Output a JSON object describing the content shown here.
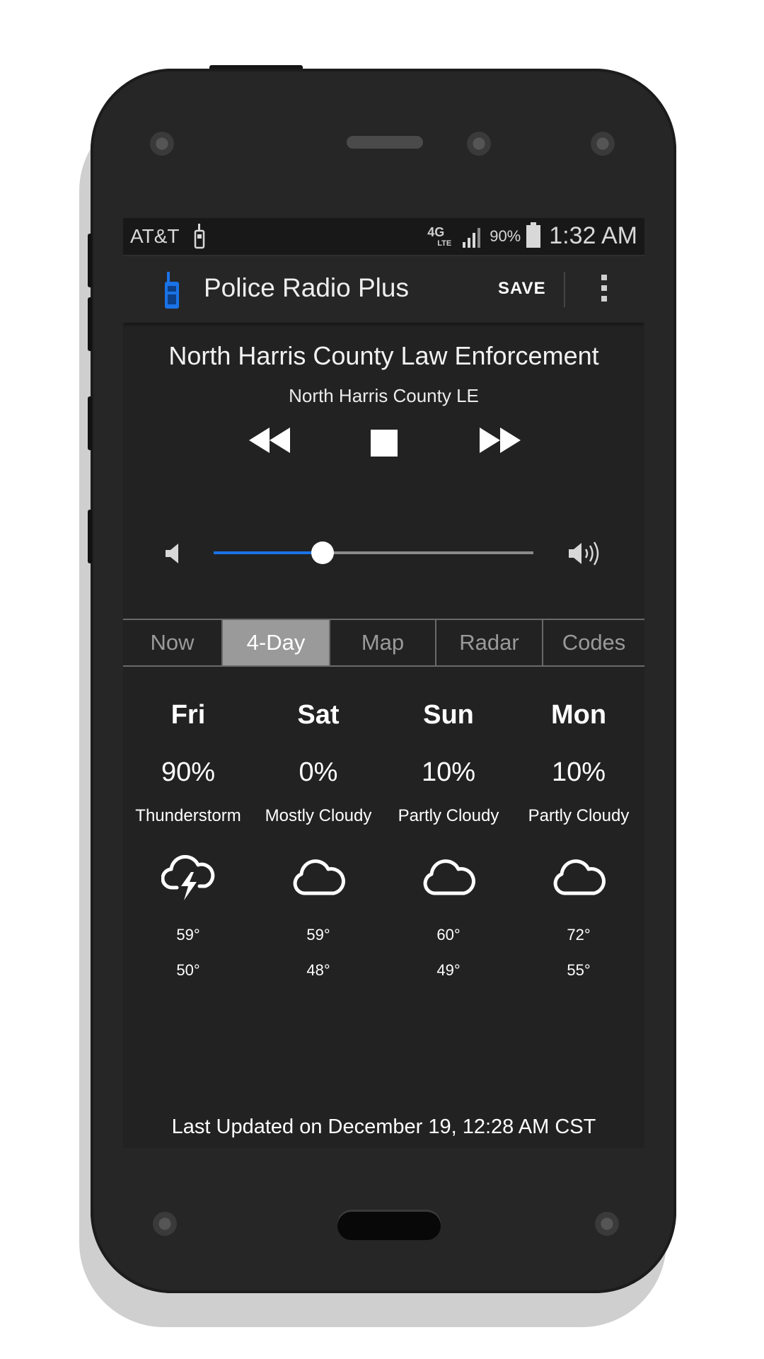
{
  "status_bar": {
    "carrier": "AT&T",
    "network": "4G",
    "network_sub": "LTE",
    "battery": "90%",
    "time": "1:32 AM"
  },
  "app_bar": {
    "title": "Police Radio Plus",
    "save_label": "SAVE"
  },
  "player": {
    "station_name": "North Harris County Law Enforcement",
    "station_short": "North Harris County LE",
    "volume_fraction": 0.34
  },
  "tabs": [
    {
      "label": "Now",
      "active": false
    },
    {
      "label": "4-Day",
      "active": true
    },
    {
      "label": "Map",
      "active": false
    },
    {
      "label": "Radar",
      "active": false
    },
    {
      "label": "Codes",
      "active": false
    }
  ],
  "forecast": [
    {
      "day": "Fri",
      "precip": "90%",
      "condition": "Thunderstorm",
      "icon": "thunderstorm-icon",
      "high": "59°",
      "low": "50°"
    },
    {
      "day": "Sat",
      "precip": "0%",
      "condition": "Mostly Cloudy",
      "icon": "cloud-icon",
      "high": "59°",
      "low": "48°"
    },
    {
      "day": "Sun",
      "precip": "10%",
      "condition": "Partly Cloudy",
      "icon": "cloud-icon",
      "high": "60°",
      "low": "49°"
    },
    {
      "day": "Mon",
      "precip": "10%",
      "condition": "Partly Cloudy",
      "icon": "cloud-icon",
      "high": "72°",
      "low": "55°"
    }
  ],
  "last_updated": "Last Updated on December 19, 12:28 AM CST",
  "colors": {
    "accent": "#1a73e8",
    "background": "#222222",
    "tab_active": "#9a9a9a"
  }
}
